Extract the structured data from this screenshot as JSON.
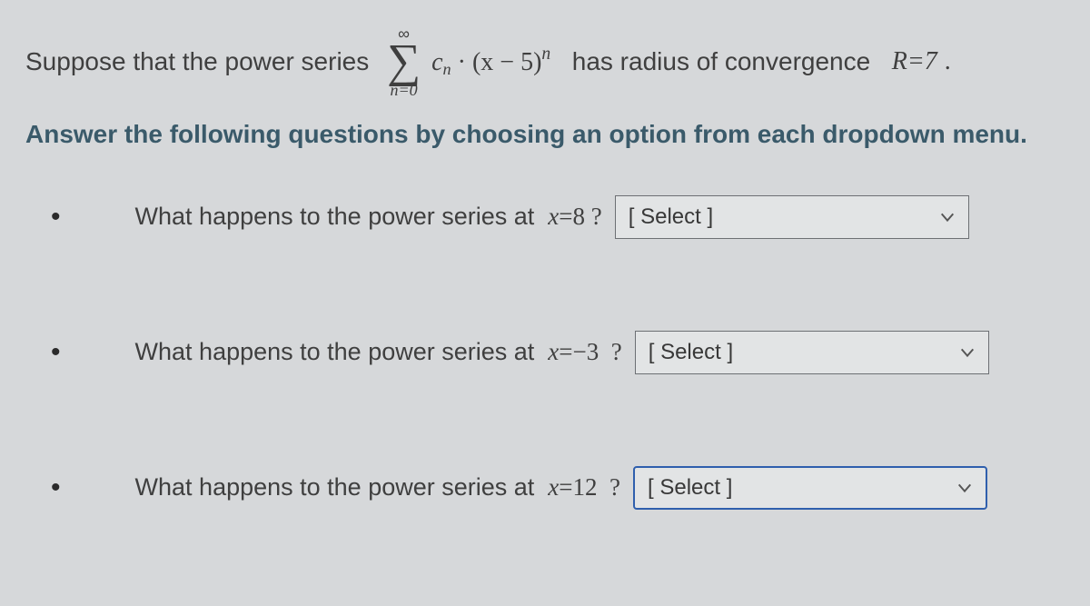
{
  "intro": {
    "prefix": "Suppose that the power series ",
    "sigma_top": "∞",
    "sigma_bottom": "n=0",
    "term_cn": "c",
    "term_cn_sub": "n",
    "term_dot": " · ",
    "term_paren": "(x − 5)",
    "term_exp": "n",
    "mid": "  has radius of convergence  ",
    "R_eq": "R=7",
    "period": "."
  },
  "instruction": "Answer the following questions by choosing an option from each dropdown menu.",
  "questions": [
    {
      "prompt_prefix": "What happens to the power series at  ",
      "x_var": "x",
      "x_eq": "=8 ?",
      "select_label": "[ Select ]",
      "active": false
    },
    {
      "prompt_prefix": "What happens to the power series at  ",
      "x_var": "x",
      "x_eq": "=−3  ?",
      "select_label": "[ Select ]",
      "active": false
    },
    {
      "prompt_prefix": "What happens to the power series at  ",
      "x_var": "x",
      "x_eq": "=12  ?",
      "select_label": "[ Select ]",
      "active": true
    }
  ]
}
